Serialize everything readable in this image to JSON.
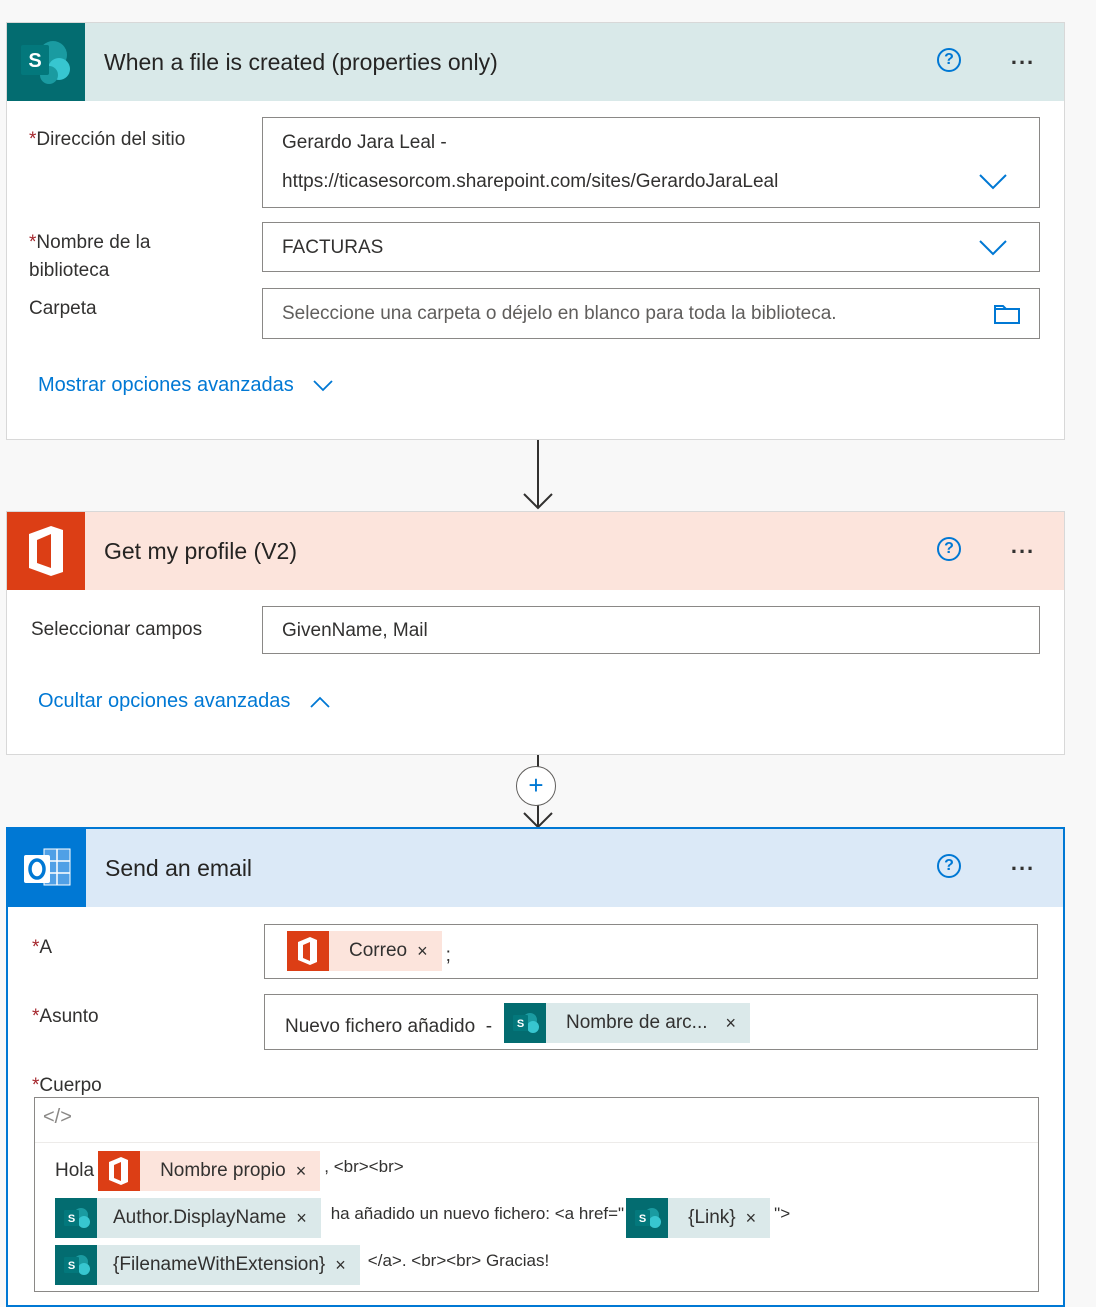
{
  "colors": {
    "sharepoint_header_bg": "#d9e9e9",
    "sharepoint_icon_bg": "#036c70",
    "office_header_bg": "#fce4dc",
    "office_icon_bg": "#dc3e15",
    "outlook_header_bg": "#dbe9f7",
    "outlook_icon_bg": "#0078d4",
    "link": "#0078d4",
    "required": "#a4262c"
  },
  "trigger": {
    "title": "When a file is created (properties only)",
    "icon": "sharepoint-icon",
    "help_label": "?",
    "more_label": "...",
    "site_label": "Dirección del sitio",
    "site_value_line1": "Gerardo Jara Leal -",
    "site_value_line2": "https://ticasesorcom.sharepoint.com/sites/GerardoJaraLeal",
    "library_label_line1": "Nombre de la",
    "library_label_line2": "biblioteca",
    "library_value": "FACTURAS",
    "folder_label": "Carpeta",
    "folder_placeholder": "Seleccione una carpeta o déjelo en blanco para toda la biblioteca.",
    "advanced_link": "Mostrar opciones avanzadas"
  },
  "profile": {
    "title": "Get my profile (V2)",
    "icon": "office-icon",
    "help_label": "?",
    "more_label": "...",
    "fields_label": "Seleccionar campos",
    "fields_value": "GivenName, Mail",
    "advanced_link": "Ocultar opciones avanzadas"
  },
  "connector": {
    "add_label": "+"
  },
  "email": {
    "title": "Send an email",
    "icon": "outlook-icon",
    "help_label": "?",
    "more_label": "...",
    "to_label": "A",
    "to_token": "Correo",
    "to_suffix": ";",
    "subject_label": "Asunto",
    "subject_prefix": "Nuevo fichero añadido  -",
    "subject_token": "Nombre de arc...",
    "body_label": "Cuerpo",
    "code_view_label": "</>",
    "body_line1_prefix": "Hola",
    "body_line1_token": "Nombre propio",
    "body_line1_suffix": ", <br><br>",
    "body_line2_token": "Author.DisplayName",
    "body_line2_mid": "ha añadido un nuevo fichero: <a href=\"",
    "body_line2_token2": "{Link}",
    "body_line2_suffix": "\">",
    "body_line3_token": "{FilenameWithExtension}",
    "body_line3_suffix": "</a>. <br><br> Gracias!"
  },
  "token_remove_label": "×",
  "required_mark": "*"
}
